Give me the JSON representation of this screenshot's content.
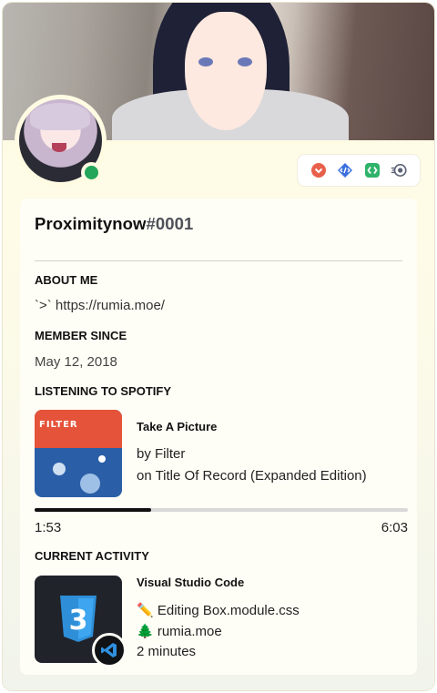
{
  "profile": {
    "username": "Proximitynow",
    "discriminator": "#0001",
    "status": "online",
    "status_color": "#23a55a"
  },
  "badges": [
    {
      "name": "chevron-down-badge-icon",
      "color": "#e8604c"
    },
    {
      "name": "code-badge-icon",
      "color": "#3b6fe0"
    },
    {
      "name": "brackets-badge-icon",
      "color": "#2fb36a"
    },
    {
      "name": "nitro-badge-icon",
      "color": "#5b6275"
    }
  ],
  "about": {
    "heading": "ABOUT ME",
    "text": "`>` https://rumia.moe/"
  },
  "member_since": {
    "heading": "MEMBER SINCE",
    "date": "May 12, 2018"
  },
  "spotify": {
    "heading": "LISTENING TO SPOTIFY",
    "album_art_text": "FILTER",
    "track": "Take A Picture",
    "artist_line": "by Filter",
    "album_line": "on Title Of Record (Expanded Edition)",
    "elapsed": "1:53",
    "duration": "6:03",
    "progress": 0.312
  },
  "activity": {
    "heading": "CURRENT ACTIVITY",
    "app": "Visual Studio Code",
    "details": "✏️ Editing Box.module.css",
    "state": "🌲 rumia.moe",
    "elapsed": "2 minutes"
  }
}
